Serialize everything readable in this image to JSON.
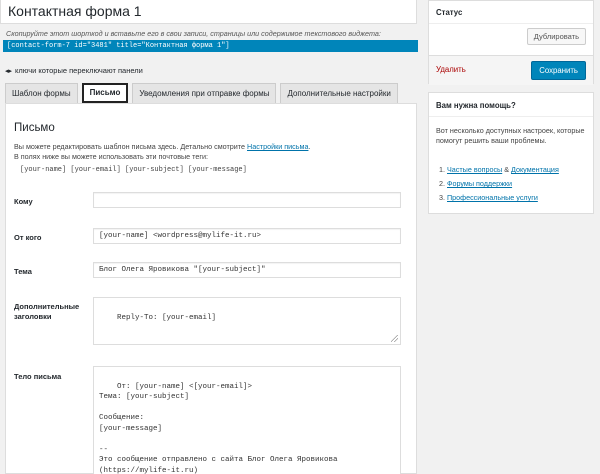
{
  "form_title": "Контактная форма 1",
  "shortcode_hint": "Скопируйте этот шорткод и вставьте его в свои записи, страницы или содержимое текстового виджета:",
  "shortcode": "[contact-form-7 id=\"3481\" title=\"Контактная форма 1\"]",
  "panel_toggle_label": "ключи которые переключают панели",
  "tabs": [
    {
      "label": "Шаблон формы"
    },
    {
      "label": "Письмо"
    },
    {
      "label": "Уведомления при отправке формы"
    },
    {
      "label": "Дополнительные настройки"
    }
  ],
  "mail": {
    "heading": "Письмо",
    "desc_prefix": "Вы можете редактировать шаблон письма здесь. Детально смотрите",
    "desc_link": "Настройки письма",
    "desc_suffix": ".",
    "desc_line2": "В полях ниже вы можете использовать эти почтовые теги:",
    "tags": "[your-name] [your-email] [your-subject] [your-message]",
    "fields": {
      "to": {
        "label": "Кому",
        "value": ""
      },
      "from": {
        "label": "От кого",
        "value": "[your-name] <wordpress@mylife-it.ru>"
      },
      "subject": {
        "label": "Тема",
        "value": "Блог Олега Яровикова \"[your-subject]\""
      },
      "headers": {
        "label": "Дополнительные заголовки",
        "value": "Reply-To: [your-email]"
      },
      "body": {
        "label": "Тело письма",
        "value": "От: [your-name] <[your-email]>\nТема: [your-subject]\n\nСообщение:\n[your-message]\n\n--\nЭто сообщение отправлено с сайта Блог Олега Яровикова\n(https://mylife-it.ru)"
      }
    }
  },
  "status": {
    "title": "Статус",
    "duplicate_label": "Дублировать",
    "delete_label": "Удалить",
    "save_label": "Сохранить"
  },
  "help": {
    "title": "Вам нужна помощь?",
    "desc": "Вот несколько доступных настроек, которые помогут решить ваши проблемы.",
    "faq_label": "Частые вопросы",
    "faq_join": " & ",
    "docs_label": "Документация",
    "support_label": "Форумы поддержки",
    "pro_label": "Профессиональные услуги"
  }
}
